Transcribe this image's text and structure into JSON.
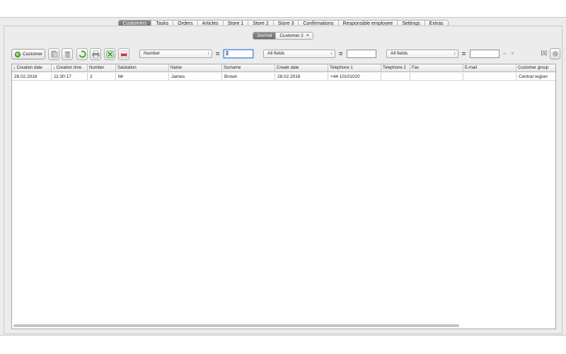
{
  "main_tabs": [
    {
      "label": "Customers",
      "active": true
    },
    {
      "label": "Tasks",
      "active": false
    },
    {
      "label": "Orders",
      "active": false
    },
    {
      "label": "Articles",
      "active": false
    },
    {
      "label": "Store 1",
      "active": false
    },
    {
      "label": "Store 2",
      "active": false
    },
    {
      "label": "Store 3",
      "active": false
    },
    {
      "label": "Confirmations",
      "active": false
    },
    {
      "label": "Responsible employee",
      "active": false
    },
    {
      "label": "Settings",
      "active": false
    },
    {
      "label": "Extras",
      "active": false
    }
  ],
  "sub_tabs": {
    "journal": "Journal",
    "customer2": "Customer 2",
    "close": "×"
  },
  "toolbar": {
    "customer_button": "Customer",
    "filter1_field": "Number",
    "filter1_eq": "=",
    "filter1_value": "2",
    "filter2_field": "All fields",
    "filter2_eq": "=",
    "filter2_value": "",
    "filter3_field": "All fields",
    "filter3_eq": "=",
    "filter3_value": "",
    "range_dash": "–",
    "clear": "×",
    "count": "[1]",
    "select_arrow": "↕"
  },
  "table": {
    "columns": [
      "↓ Creation date",
      "↓ Creation time",
      "Number",
      "Salutation",
      "Name",
      "Surname",
      "Create date",
      "Telephone 1",
      "Telephone 2",
      "Fax",
      "E-mail",
      "Customer group"
    ],
    "rows": [
      [
        "28.02.2016",
        "11:30:17",
        "2",
        "Mr",
        "James",
        "Brown",
        "28.02.2016",
        "+44 10101020",
        "",
        "",
        "",
        "Central region"
      ]
    ]
  }
}
